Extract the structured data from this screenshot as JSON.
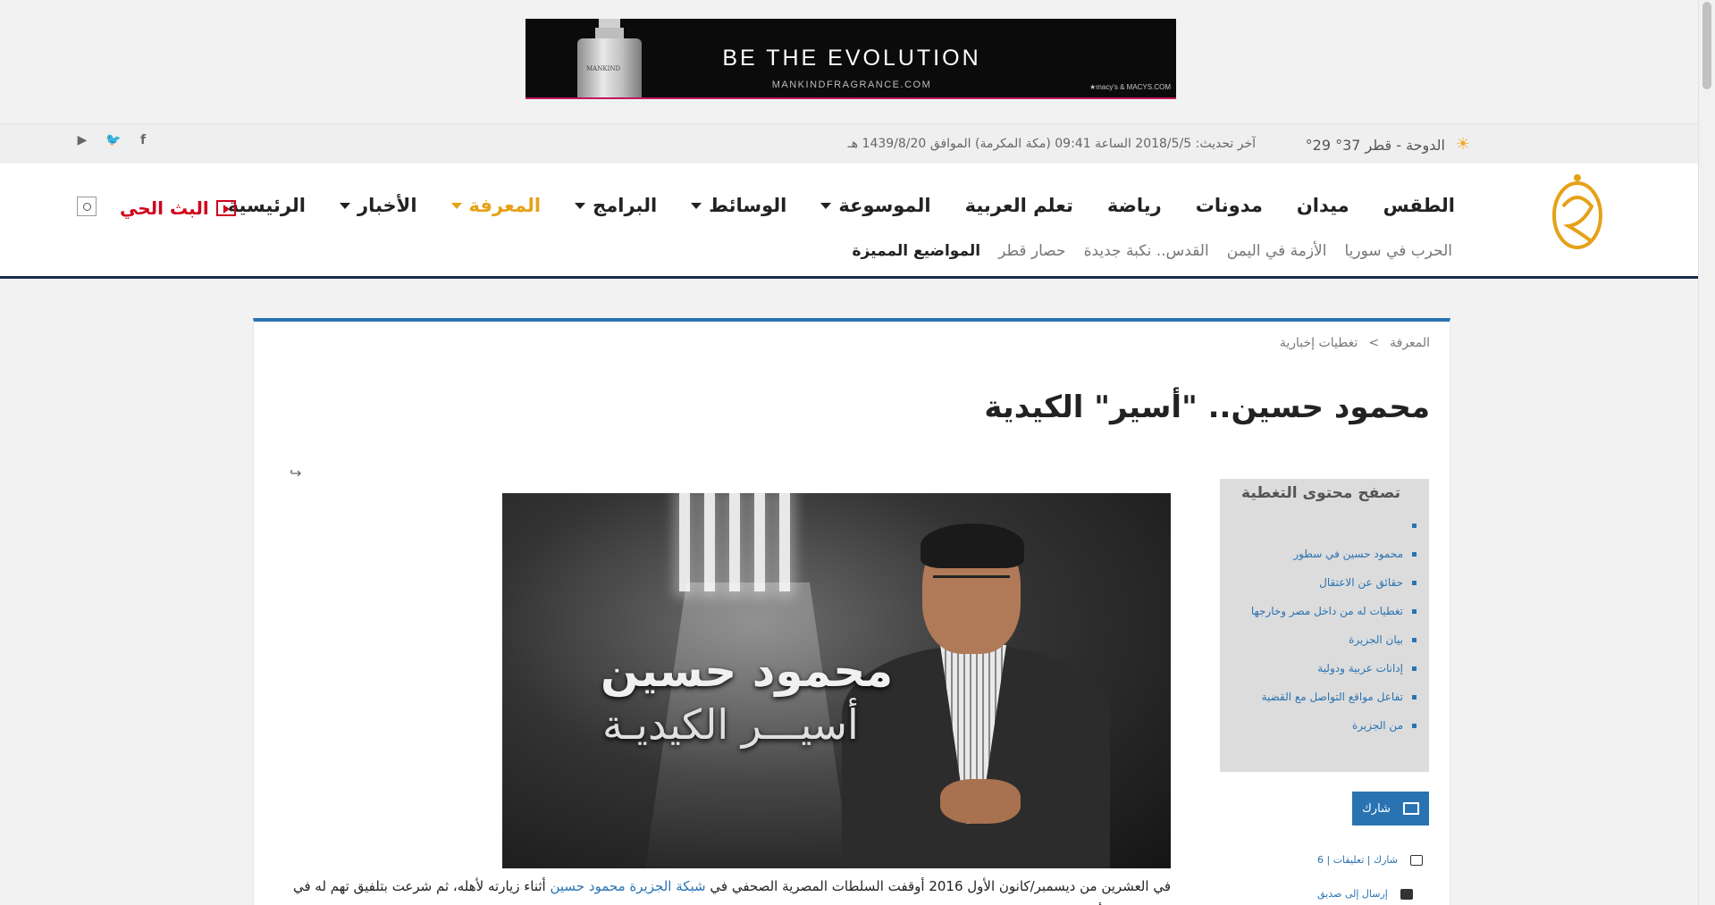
{
  "ad": {
    "headline": "BE THE EVOLUTION",
    "url": "MANKINDFRAGRANCE.COM",
    "sponsor": "★macy's & MACYS.COM",
    "bottle_label": "MANKIND"
  },
  "info_bar": {
    "weather": "الدوحة - قطر 37° 29°",
    "update": "آخر تحديث: 2018/5/5 الساعة 09:41 (مكة المكرمة) الموافق 1439/8/20 هـ"
  },
  "nav": {
    "items": [
      {
        "label": "الرئيسية",
        "dropdown": false,
        "active": false
      },
      {
        "label": "الأخبار",
        "dropdown": true,
        "active": false
      },
      {
        "label": "المعرفة",
        "dropdown": true,
        "active": true
      },
      {
        "label": "البرامج",
        "dropdown": true,
        "active": false
      },
      {
        "label": "الوسائط",
        "dropdown": true,
        "active": false
      },
      {
        "label": "الموسوعة",
        "dropdown": true,
        "active": false
      },
      {
        "label": "تعلم العربية",
        "dropdown": false,
        "active": false
      },
      {
        "label": "رياضة",
        "dropdown": false,
        "active": false
      },
      {
        "label": "مدونات",
        "dropdown": false,
        "active": false
      },
      {
        "label": "ميدان",
        "dropdown": false,
        "active": false
      },
      {
        "label": "الطقس",
        "dropdown": false,
        "active": false
      }
    ],
    "live": "البث الحي"
  },
  "featured": {
    "label": "المواضيع المميزة",
    "topics": [
      "حصار قطر",
      "القدس.. نكبة جديدة",
      "الأزمة في اليمن",
      "الحرب في سوريا"
    ]
  },
  "breadcrumb": {
    "items": [
      "المعرفة",
      ">",
      "تغطيات إخبارية"
    ]
  },
  "article": {
    "title": "محمود حسين.. \"أسير\" الكيدية",
    "hero_line1": "محمود حسين",
    "hero_line2": "أسيـــر الكيديـة",
    "body_part1": "في العشرين من ديسمبر/كانون الأول 2016 أوقفت السلطات المصرية الصحفي في ",
    "body_link": "شبكة الجزيرة محمود حسين",
    "body_part2": " أثناء زيارته لأهله، ثم شرعت بتلفيق تهم له في سلوك سبق أن مورس مع عشرات الصحفيين المصريين والعرب والغربيين وبينهم زملاء لحسين من شبكة الجزيرة."
  },
  "sidebar": {
    "toc_title": "تصفح محتوى التغطية",
    "toc_items": [
      "",
      "محمود حسين في سطور",
      "حقائق عن الاعتقال",
      "تغطيات له من داخل مصر وخارجها",
      "بيان الجزيرة",
      "إدانات عربية ودولية",
      "تفاعل مواقع التواصل مع القضية",
      "من الجزيرة"
    ],
    "share_label": "شارك",
    "comments_label": "شارك | تعليقات | 6",
    "send_label": "إرسال إلى صديق"
  },
  "colors": {
    "accent_blue": "#2a73b2",
    "active_orange": "#e6a117",
    "live_red": "#d0021b",
    "header_border": "#1a2b4c"
  }
}
